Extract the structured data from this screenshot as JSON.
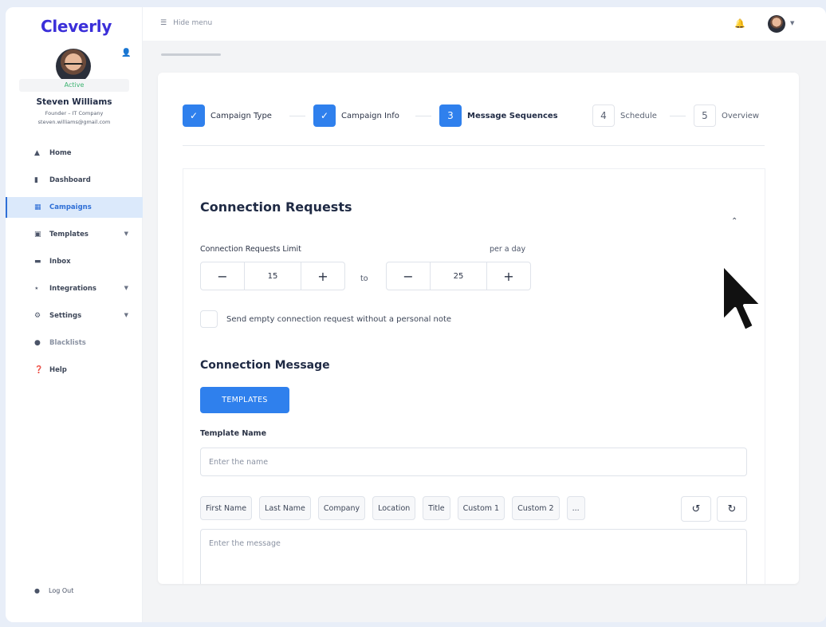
{
  "app": {
    "logo": "Cleverly"
  },
  "user": {
    "status": "Active",
    "name": "Steven Williams",
    "role": "Founder – IT Company",
    "email": "steven.williams@gmail.com"
  },
  "sidebar": {
    "items": [
      {
        "label": "Home",
        "icon": "home-icon"
      },
      {
        "label": "Dashboard",
        "icon": "bar-chart-icon"
      },
      {
        "label": "Campaigns",
        "icon": "grid-icon"
      },
      {
        "label": "Templates",
        "icon": "chat-icon"
      },
      {
        "label": "Inbox",
        "icon": "inbox-icon"
      },
      {
        "label": "Integrations",
        "icon": "integrations-icon"
      },
      {
        "label": "Settings",
        "icon": "gear-icon"
      },
      {
        "label": "Blacklists",
        "icon": "blacklist-icon"
      },
      {
        "label": "Help",
        "icon": "help-icon"
      }
    ],
    "logout": "Log Out"
  },
  "topbar": {
    "hide_menu": "Hide menu"
  },
  "stepper": {
    "steps": [
      {
        "number": "",
        "label": "Campaign Type"
      },
      {
        "number": "",
        "label": "Campaign Info"
      },
      {
        "number": "3",
        "label": "Message Sequences"
      },
      {
        "number": "4",
        "label": "Schedule"
      },
      {
        "number": "5",
        "label": "Overview"
      }
    ]
  },
  "connection_requests": {
    "title": "Connection Requests",
    "limit_label": "Connection Requests Limit",
    "per_day": "per a day",
    "min_value": "15",
    "to_label": "to",
    "max_value": "25",
    "checkbox_label": "Send empty connection request without a personal note"
  },
  "connection_message": {
    "title": "Connection Message",
    "templates_button": "TEMPLATES",
    "template_name_label": "Template Name",
    "template_name_placeholder": "Enter the name",
    "tags": [
      "First Name",
      "Last Name",
      "Company",
      "Location",
      "Title",
      "Custom 1",
      "Custom 2",
      "..."
    ],
    "message_placeholder": "Enter the message"
  },
  "colors": {
    "brand": "#3b2fd9",
    "accent": "#2f80ed",
    "active_status": "#3cb371"
  }
}
